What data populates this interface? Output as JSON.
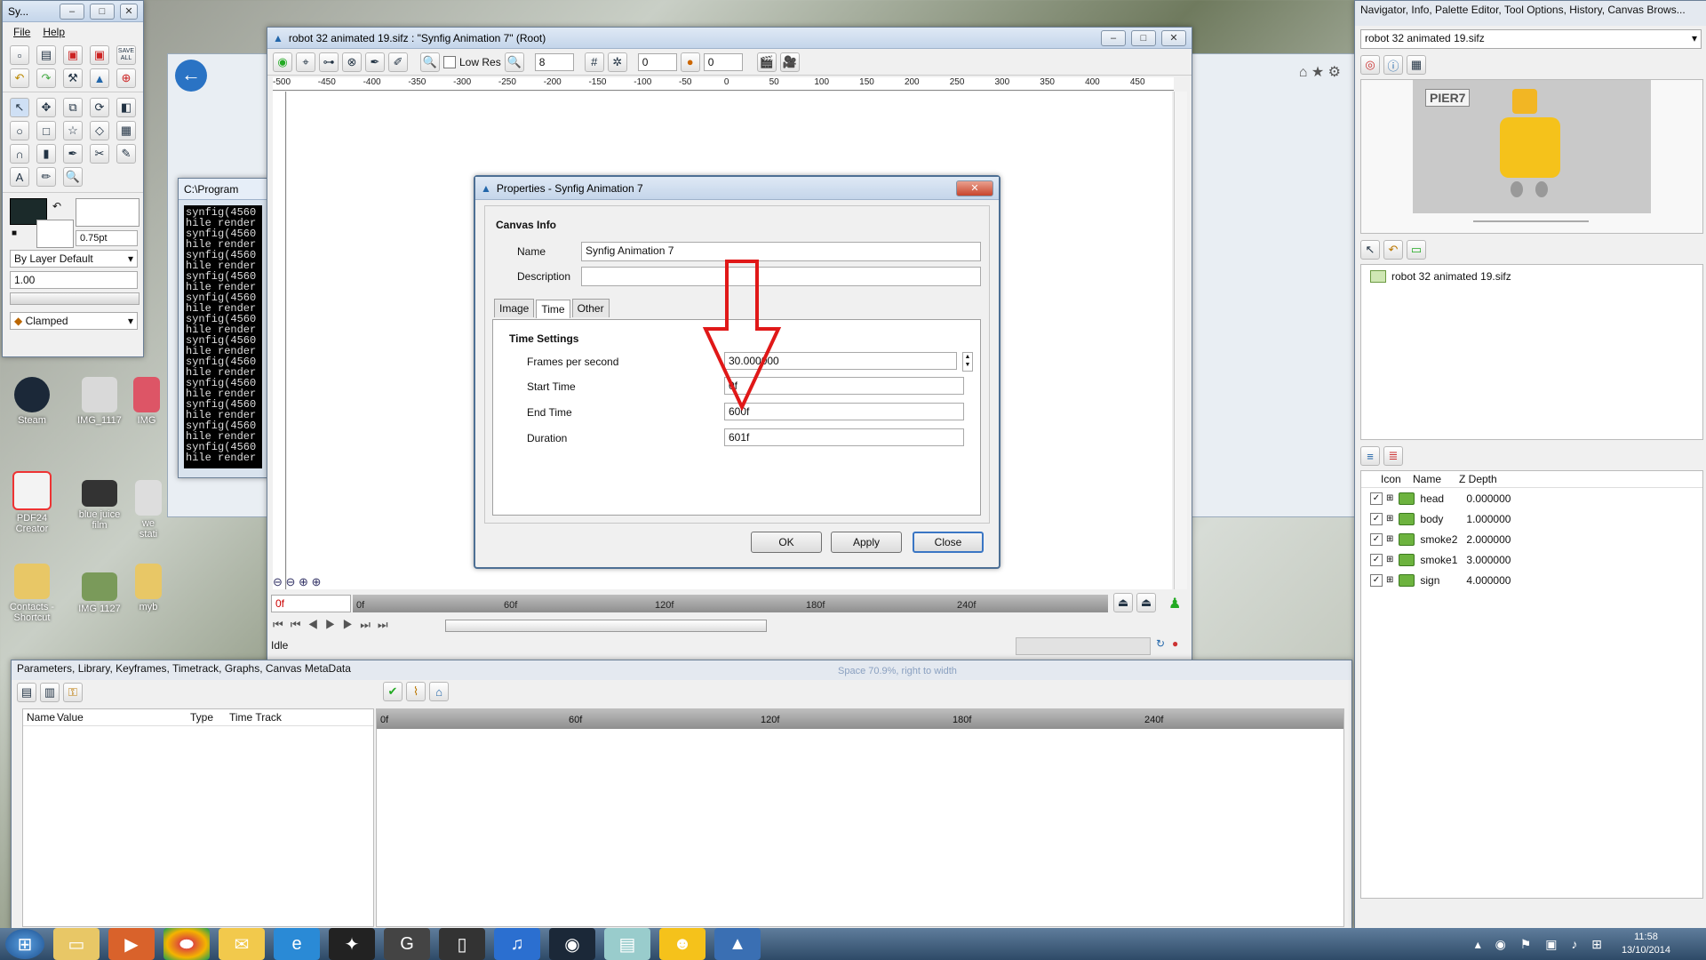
{
  "desktop": {
    "icons": [
      {
        "label": "Steam",
        "color": "#1b2838"
      },
      {
        "label": "IMG_1117",
        "color": "#cfcfcf"
      },
      {
        "label": "IMG",
        "color": "#d56"
      },
      {
        "label": "PDF24 Creator",
        "color": "#e33"
      },
      {
        "label": "blue juice film",
        "color": "#444"
      },
      {
        "label": "we stati",
        "color": "#ddd"
      },
      {
        "label": "Contacts - Shortcut",
        "color": "#e8c766"
      },
      {
        "label": "IMG 1127",
        "color": "#7a9a5a"
      },
      {
        "label": "myb",
        "color": "#e8c766"
      }
    ]
  },
  "toolbox": {
    "title": "Sy...",
    "menu": [
      "File",
      "Help"
    ],
    "brush_size": "0.75pt",
    "blend_method": "By Layer Default",
    "amount": "1.00",
    "interpolation": "Clamped",
    "save_all": "SAVE ALL"
  },
  "console": {
    "title": "C:\\Program",
    "lines": [
      "synfig(4560",
      "hile render",
      "synfig(4560",
      "hile render",
      "synfig(4560",
      "hile render",
      "synfig(4560",
      "hile render",
      "synfig(4560",
      "hile render",
      "synfig(4560",
      "hile render",
      "synfig(4560",
      "hile render",
      "synfig(4560",
      "hile render",
      "synfig(4560",
      "hile render",
      "synfig(4560",
      "hile render",
      "synfig(4560",
      "hile render",
      "synfig(4560",
      "hile render"
    ]
  },
  "main_window": {
    "title": "robot 32 animated 19.sifz : \"Synfig Animation 7\" (Root)",
    "low_res_label": "Low Res",
    "grid_value": "8",
    "onion_past": "0",
    "onion_future": "0",
    "ruler_ticks": [
      "-500",
      "-450",
      "-400",
      "-350",
      "-300",
      "-250",
      "-200",
      "-150",
      "-100",
      "-50",
      "0",
      "50",
      "100",
      "150",
      "200",
      "250",
      "300",
      "350",
      "400",
      "450"
    ],
    "current_time": "0f",
    "timebar_ticks": [
      "0f",
      "60f",
      "120f",
      "180f",
      "240f"
    ],
    "status": "Idle"
  },
  "dialog": {
    "title": "Properties - Synfig Animation 7",
    "section": "Canvas Info",
    "name_label": "Name",
    "name_value": "Synfig Animation 7",
    "description_label": "Description",
    "description_value": "",
    "tabs": [
      "Image",
      "Time",
      "Other"
    ],
    "time_settings": "Time Settings",
    "fps_label": "Frames per second",
    "fps_value": "30.000000",
    "start_label": "Start Time",
    "start_value": "0f",
    "end_label": "End Time",
    "end_value": "600f",
    "duration_label": "Duration",
    "duration_value": "601f",
    "ok": "OK",
    "apply": "Apply",
    "close": "Close",
    "annotation_color": "#e01818"
  },
  "bottom_panel": {
    "title": "Parameters, Library, Keyframes, Timetrack, Graphs, Canvas MetaData",
    "columns": [
      "Name",
      "Value",
      "Type",
      "Time Track"
    ],
    "ticks": [
      "0f",
      "60f",
      "120f",
      "180f",
      "240f"
    ],
    "watermark": "Space 70.9%, right to width"
  },
  "right_panel": {
    "title": "Navigator, Info, Palette Editor, Tool Options, History, Canvas Brows...",
    "file_select": "robot 32 animated 19.sifz",
    "preview_sign": "PIER7",
    "tree_item": "robot 32 animated 19.sifz",
    "layer_columns": [
      "Icon",
      "Name",
      "Z Depth"
    ],
    "layers": [
      {
        "name": "head",
        "z": "0.000000"
      },
      {
        "name": "body",
        "z": "1.000000"
      },
      {
        "name": "smoke2",
        "z": "2.000000"
      },
      {
        "name": "smoke1",
        "z": "3.000000"
      },
      {
        "name": "sign",
        "z": "4.000000"
      }
    ]
  },
  "taskbar": {
    "time": "11:58",
    "date": "13/10/2014"
  }
}
